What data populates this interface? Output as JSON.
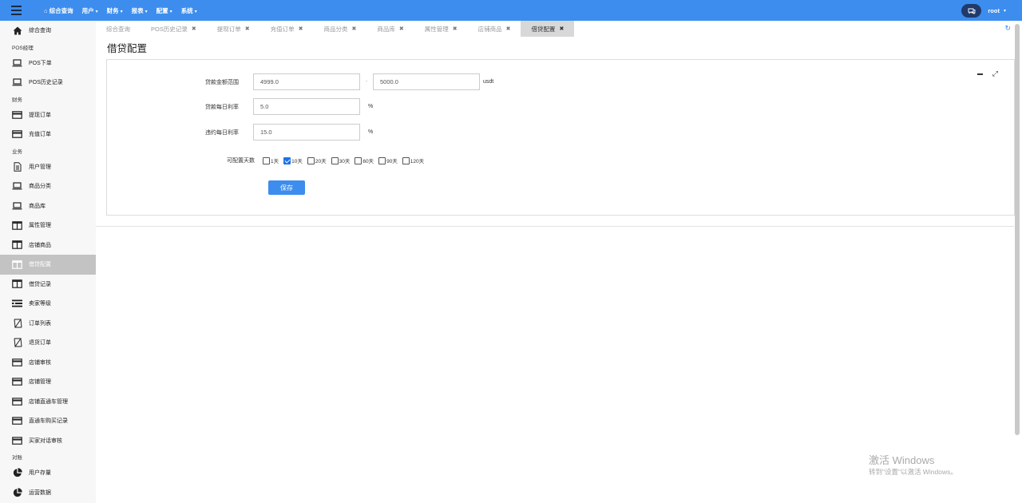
{
  "topnav": {
    "home": "综合查询",
    "items": [
      "用户",
      "财务",
      "报表",
      "配置",
      "系统"
    ],
    "user": "root"
  },
  "sidebar": {
    "items": [
      {
        "label": "综合查询",
        "icon": "home-icon"
      },
      {
        "group": "POS经理"
      },
      {
        "label": "POS下单",
        "icon": "laptop-icon"
      },
      {
        "label": "POS历史记录",
        "icon": "laptop-icon"
      },
      {
        "group": "财务"
      },
      {
        "label": "提现订单",
        "icon": "card-icon"
      },
      {
        "label": "充值订单",
        "icon": "card-icon"
      },
      {
        "group": "业务"
      },
      {
        "label": "用户管理",
        "icon": "document-icon"
      },
      {
        "label": "商品分类",
        "icon": "laptop-icon"
      },
      {
        "label": "商品库",
        "icon": "laptop-icon"
      },
      {
        "label": "属性管理",
        "icon": "columns-icon"
      },
      {
        "label": "店铺商品",
        "icon": "columns-icon"
      },
      {
        "label": "借贷配置",
        "icon": "columns-icon",
        "active": true
      },
      {
        "label": "借贷记录",
        "icon": "columns-icon"
      },
      {
        "label": "卖家等级",
        "icon": "list-icon"
      },
      {
        "label": "订单列表",
        "icon": "hourglass-icon"
      },
      {
        "label": "退货订单",
        "icon": "hourglass-icon"
      },
      {
        "label": "店铺审核",
        "icon": "card-icon"
      },
      {
        "label": "店铺管理",
        "icon": "card-icon"
      },
      {
        "label": "店铺直通车管理",
        "icon": "card-icon"
      },
      {
        "label": "直通车购买记录",
        "icon": "card-icon"
      },
      {
        "label": "买家对话审核",
        "icon": "card-icon"
      },
      {
        "group": "对账"
      },
      {
        "label": "用户存量",
        "icon": "pie-icon"
      },
      {
        "label": "运营数据",
        "icon": "pie-icon"
      }
    ]
  },
  "tabs": [
    {
      "label": "综合查询",
      "closable": false
    },
    {
      "label": "POS历史记录",
      "closable": true
    },
    {
      "label": "提现订单",
      "closable": true
    },
    {
      "label": "充值订单",
      "closable": true
    },
    {
      "label": "商品分类",
      "closable": true
    },
    {
      "label": "商品库",
      "closable": true
    },
    {
      "label": "属性管理",
      "closable": true
    },
    {
      "label": "店铺商品",
      "closable": true
    },
    {
      "label": "借贷配置",
      "closable": true,
      "active": true
    }
  ],
  "page": {
    "title": "借贷配置"
  },
  "form": {
    "amount_range": {
      "label": "贷款金额范围",
      "min": "4999.0",
      "max": "5000.0",
      "dash": "-",
      "unit": "usdt"
    },
    "daily_rate": {
      "label": "贷款每日利率",
      "value": "5.0",
      "unit": "%"
    },
    "penalty_rate": {
      "label": "违约每日利率",
      "value": "15.0",
      "unit": "%"
    },
    "days": {
      "label": "可配置天数",
      "options": [
        {
          "label": "1天",
          "checked": false
        },
        {
          "label": "10天",
          "checked": true
        },
        {
          "label": "20天",
          "checked": false
        },
        {
          "label": "30天",
          "checked": false
        },
        {
          "label": "60天",
          "checked": false
        },
        {
          "label": "90天",
          "checked": false
        },
        {
          "label": "120天",
          "checked": false
        }
      ]
    },
    "save_label": "保存"
  },
  "watermark": {
    "title": "激活 Windows",
    "subtitle": "转到\"设置\"以激活 Windows。"
  },
  "colors": {
    "topbar": "#3c8dee",
    "accent": "#3c8dee",
    "active_sidebar": "#c3c3c3"
  }
}
